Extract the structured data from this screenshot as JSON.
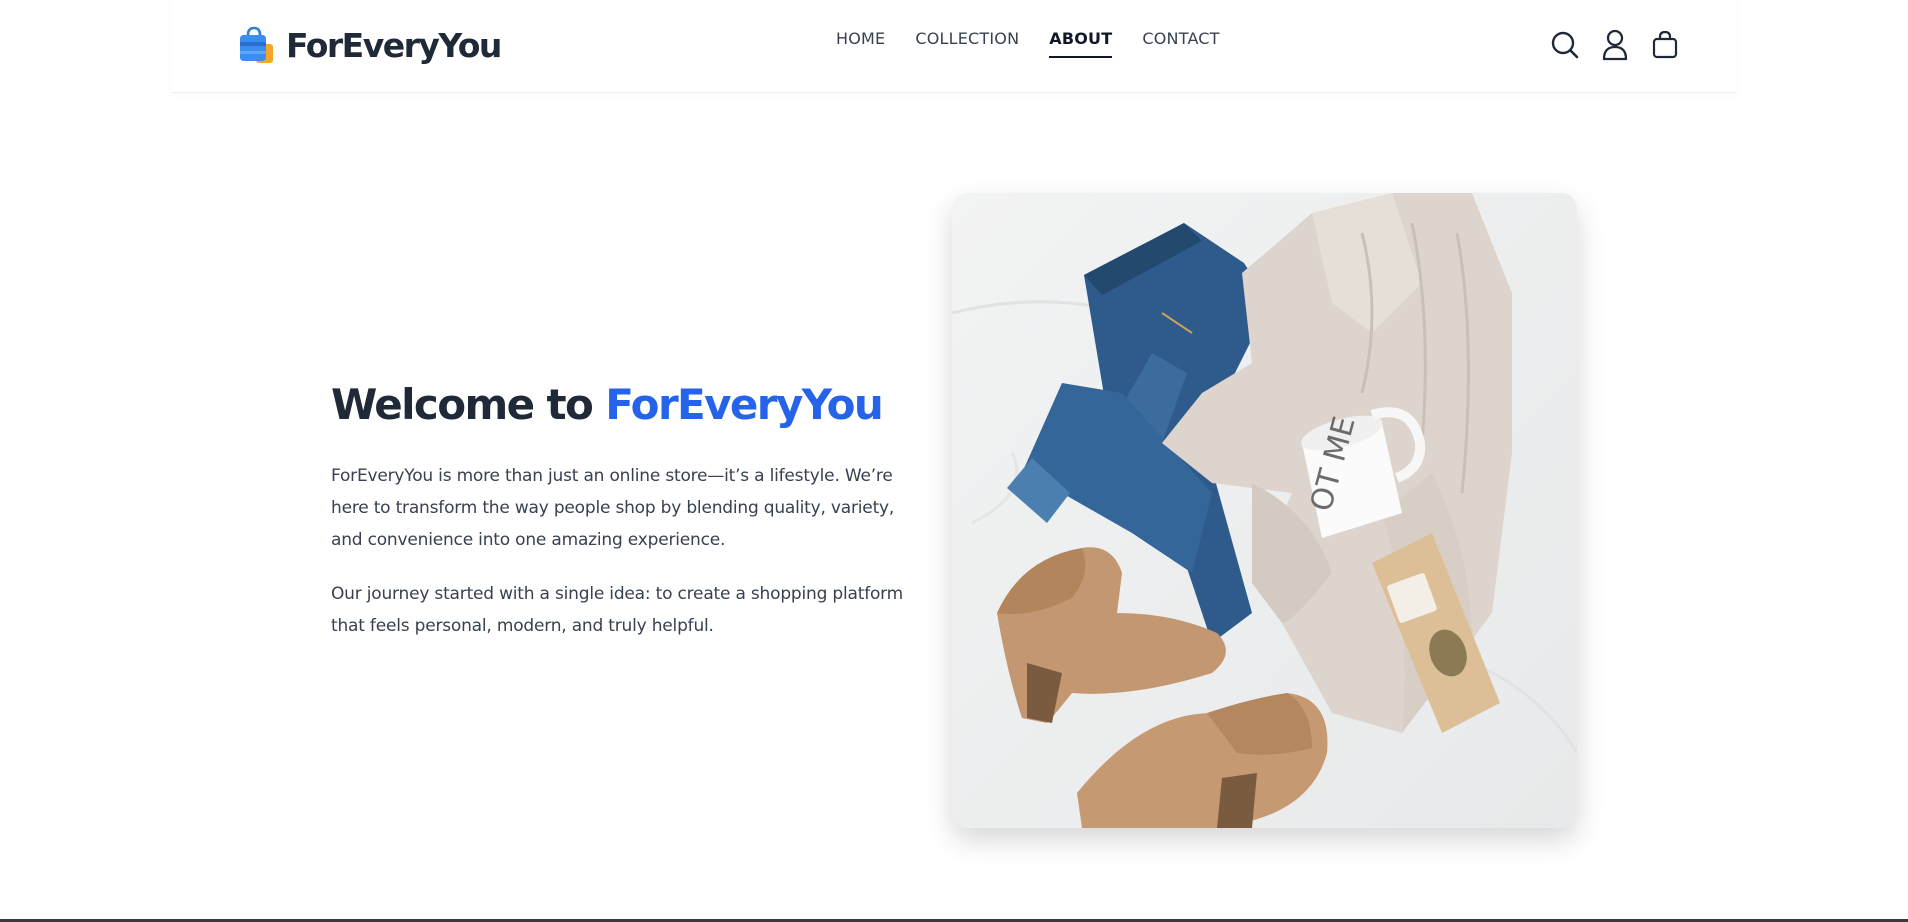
{
  "brand": {
    "name": "ForEveryYou",
    "logo_icon": "shopping-bag-icon"
  },
  "nav": {
    "items": [
      {
        "label": "HOME",
        "active": false
      },
      {
        "label": "COLLECTION",
        "active": false
      },
      {
        "label": "ABOUT",
        "active": true
      },
      {
        "label": "CONTACT",
        "active": false
      }
    ]
  },
  "header_icons": [
    "search-icon",
    "user-icon",
    "cart-icon"
  ],
  "about": {
    "title_prefix": "Welcome to ",
    "title_brand": "ForEveryYou",
    "paragraph_1": "ForEveryYou is more than just an online store—it’s a lifestyle. We’re here to transform the way people shop by blending quality, variety, and convenience into one amazing experience.",
    "paragraph_2": "Our journey started with a single idea: to create a shopping platform that feels personal, modern, and truly helpful.",
    "mug_text": "OT ME"
  },
  "colors": {
    "accent": "#2563eb",
    "text_dark": "#1f2937",
    "text_body": "#374151"
  }
}
